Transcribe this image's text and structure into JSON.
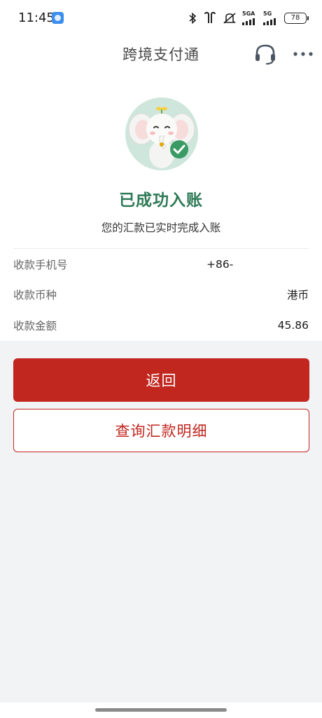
{
  "status_bar": {
    "time": "11:45",
    "net1": "5GA",
    "net2": "5G",
    "battery": "78"
  },
  "nav": {
    "title": "跨境支付通",
    "support_icon": "headset-icon",
    "more_icon": "more-dots-icon"
  },
  "result": {
    "title": "已成功入账",
    "subtitle": "您的汇款已实时完成入账",
    "title_color": "#2f7a57"
  },
  "details": [
    {
      "label": "收款手机号",
      "value": "+86-"
    },
    {
      "label": "收款币种",
      "value": "港币"
    },
    {
      "label": "收款金额",
      "value": "45.86"
    }
  ],
  "actions": {
    "back_label": "返回",
    "query_label": "查询汇款明细",
    "accent_color": "#c1271f"
  }
}
